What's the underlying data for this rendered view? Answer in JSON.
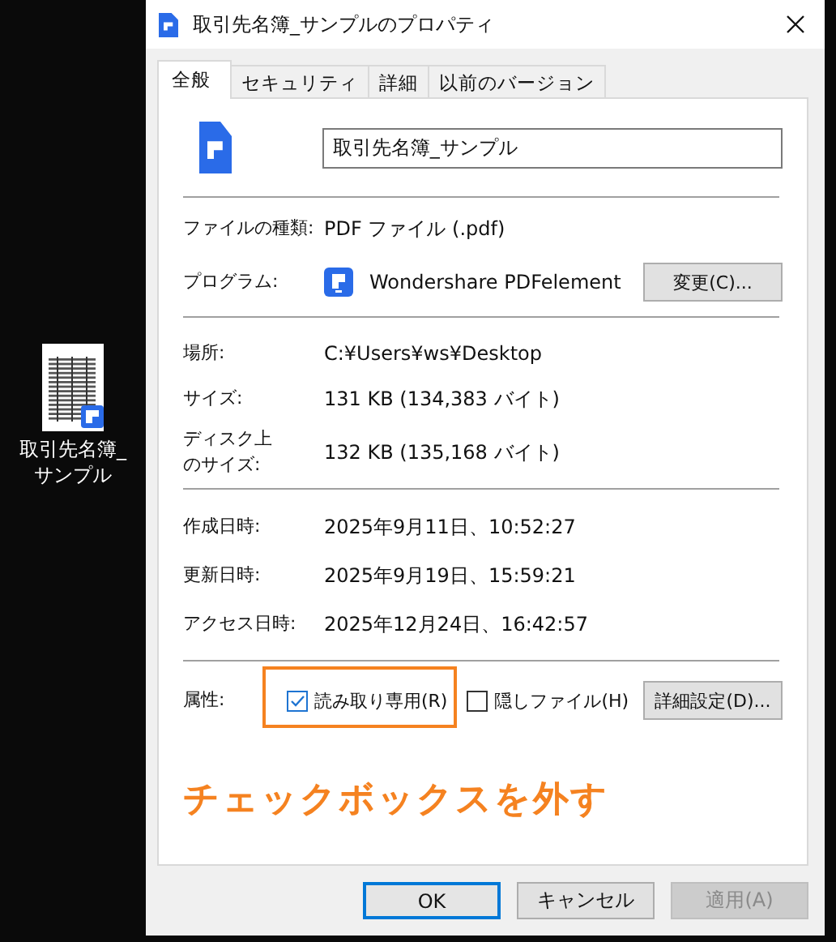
{
  "desktop": {
    "file_label": "取引先名簿_サンプル"
  },
  "dialog": {
    "title": "取引先名簿_サンプルのプロパティ",
    "tabs": [
      {
        "label": "全般",
        "selected": true
      },
      {
        "label": "セキュリティ",
        "selected": false
      },
      {
        "label": "詳細",
        "selected": false
      },
      {
        "label": "以前のバージョン",
        "selected": false
      }
    ],
    "name_field": {
      "value": "取引先名簿_サンプル"
    },
    "sections": [
      {
        "rows": [
          {
            "kind": "text",
            "label": "ファイルの種類:",
            "value": "PDF ファイル (.pdf)"
          },
          {
            "kind": "program",
            "label": "プログラム:",
            "value": "Wondershare PDFelement",
            "button": "変更(C)..."
          }
        ]
      },
      {
        "rows": [
          {
            "kind": "text",
            "label": "場所:",
            "value": "C:¥Users¥ws¥Desktop"
          },
          {
            "kind": "text",
            "label": "サイズ:",
            "value": "131 KB (134,383 バイト)"
          },
          {
            "kind": "text",
            "label": "ディスク上のサイズ:",
            "value": "132 KB (135,168 バイト)"
          }
        ]
      },
      {
        "rows": [
          {
            "kind": "text",
            "label": "作成日時:",
            "value": "2025年9月11日、10:52:27"
          },
          {
            "kind": "text",
            "label": "更新日時:",
            "value": "2025年9月19日、15:59:21"
          },
          {
            "kind": "text",
            "label": "アクセス日時:",
            "value": "2025年12月24日、16:42:57"
          }
        ]
      }
    ],
    "attributes": {
      "label": "属性:",
      "checkboxes": [
        {
          "label": "読み取り専用(R)",
          "checked": true,
          "highlighted": true
        },
        {
          "label": "隠しファイル(H)",
          "checked": false,
          "highlighted": false
        }
      ],
      "button": "詳細設定(D)..."
    },
    "annotation": {
      "text": "チェックボックスを外す"
    },
    "buttons": [
      {
        "label": "OK",
        "default": true,
        "disabled": false
      },
      {
        "label": "キャンセル",
        "default": false,
        "disabled": false
      },
      {
        "label": "適用(A)",
        "default": false,
        "disabled": true
      }
    ]
  }
}
